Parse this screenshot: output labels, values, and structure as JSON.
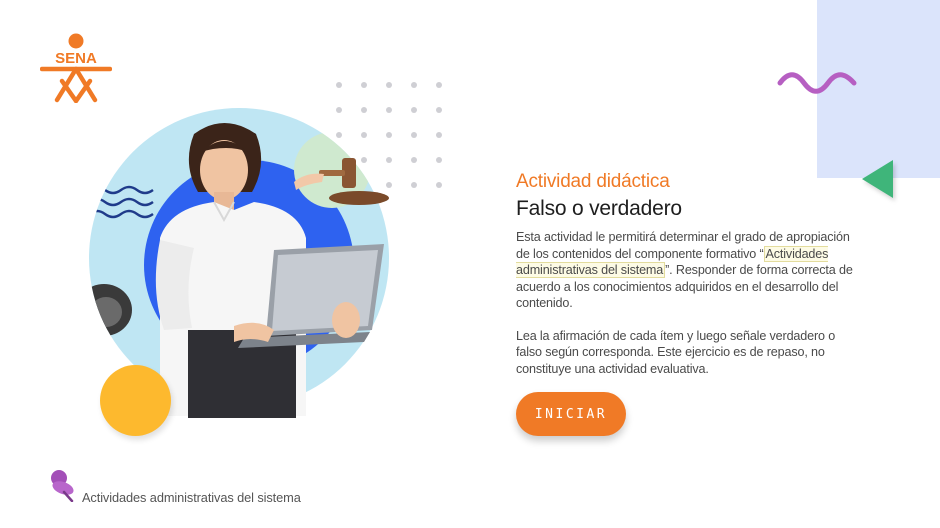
{
  "brand": {
    "logo_text": "SENA",
    "logo_color": "#f07a26"
  },
  "activity": {
    "subtitle": "Actividad didáctica",
    "title": "Falso o verdadero",
    "p1_before": "Esta actividad le permitirá determinar el grado de apropiación de los contenidos del componente formativo “",
    "p1_highlight": "Actividades administrativas del sistema",
    "p1_after": "”.  Responder de forma correcta de acuerdo a los conocimientos adquiridos en el desarrollo del contenido.",
    "p2": "Lea la afirmación de cada ítem y luego señale verdadero o falso según corresponda.  Este ejercicio es de repaso, no constituye una actividad evaluativa."
  },
  "start_button": {
    "label": "INICIAR"
  },
  "footer": {
    "course_name": "Actividades administrativas del sistema"
  },
  "colors": {
    "accent": "#f07a26",
    "panel_bg": "#dbe4fb",
    "triangle": "#3fb57a",
    "wave": "#b65fc2",
    "yellow": "#fdb92e",
    "hero_ring": "#bfe6f3",
    "hero_inner": "#2e62f0",
    "footer_icon": "#a34fb8"
  },
  "icons": [
    "sena-logo-icon",
    "wave-decoration-icon",
    "triangle-decoration-icon",
    "dot-grid-decoration",
    "gavel-icon",
    "laptop-icon",
    "pushpin-icon"
  ]
}
